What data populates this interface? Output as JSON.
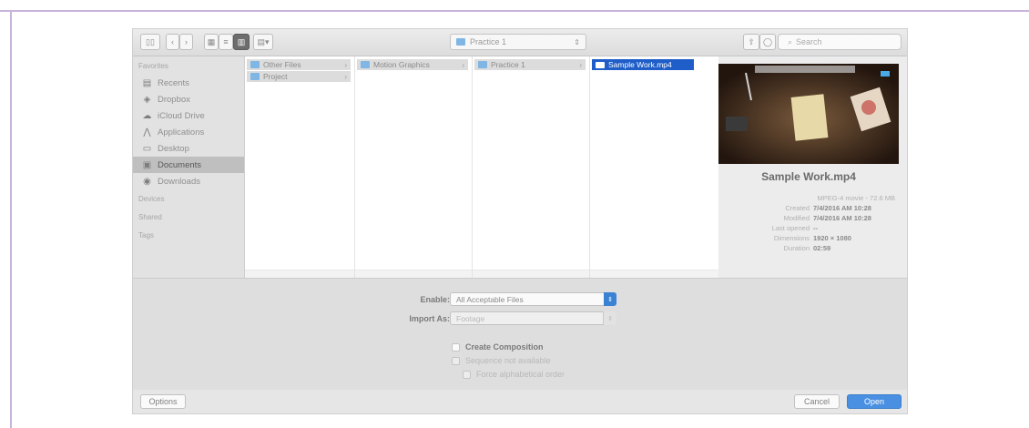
{
  "toolbar": {
    "back_label": "‹",
    "forward_label": "›",
    "location": "Practice 1",
    "search_placeholder": "Search"
  },
  "sidebar": {
    "favorites_header": "Favorites",
    "devices_header": "Devices",
    "shared_header": "Shared",
    "tags_header": "Tags",
    "items": [
      {
        "label": "Recents",
        "icon": "recents-icon"
      },
      {
        "label": "Dropbox",
        "icon": "dropbox-icon"
      },
      {
        "label": "iCloud Drive",
        "icon": "cloud-icon"
      },
      {
        "label": "Applications",
        "icon": "applications-icon"
      },
      {
        "label": "Desktop",
        "icon": "desktop-icon"
      },
      {
        "label": "Documents",
        "icon": "documents-icon"
      },
      {
        "label": "Downloads",
        "icon": "downloads-icon"
      }
    ]
  },
  "browser": {
    "col1": [
      "Other Files",
      "Project"
    ],
    "col2": [
      "Motion Graphics"
    ],
    "col3": [
      "Practice 1"
    ],
    "col4": [
      "Sample Work.mp4"
    ]
  },
  "preview": {
    "title": "Sample Work.mp4",
    "kind": "MPEG-4 movie - 72.6 MB",
    "rows": [
      {
        "k": "Created",
        "v": "7/4/2016 AM 10:28"
      },
      {
        "k": "Modified",
        "v": "7/4/2016 AM 10:28"
      },
      {
        "k": "Last opened",
        "v": "--"
      },
      {
        "k": "Dimensions",
        "v": "1920 × 1080"
      },
      {
        "k": "Duration",
        "v": "02:59"
      }
    ]
  },
  "options": {
    "enable_label": "Enable:",
    "enable_value": "All Acceptable Files",
    "import_as_label": "Import As:",
    "import_as_value": "Footage",
    "create_composition": "Create Composition",
    "sequence": "Sequence not available",
    "force_alpha": "Force alphabetical order"
  },
  "footer": {
    "options_label": "Options",
    "cancel_label": "Cancel",
    "open_label": "Open"
  }
}
